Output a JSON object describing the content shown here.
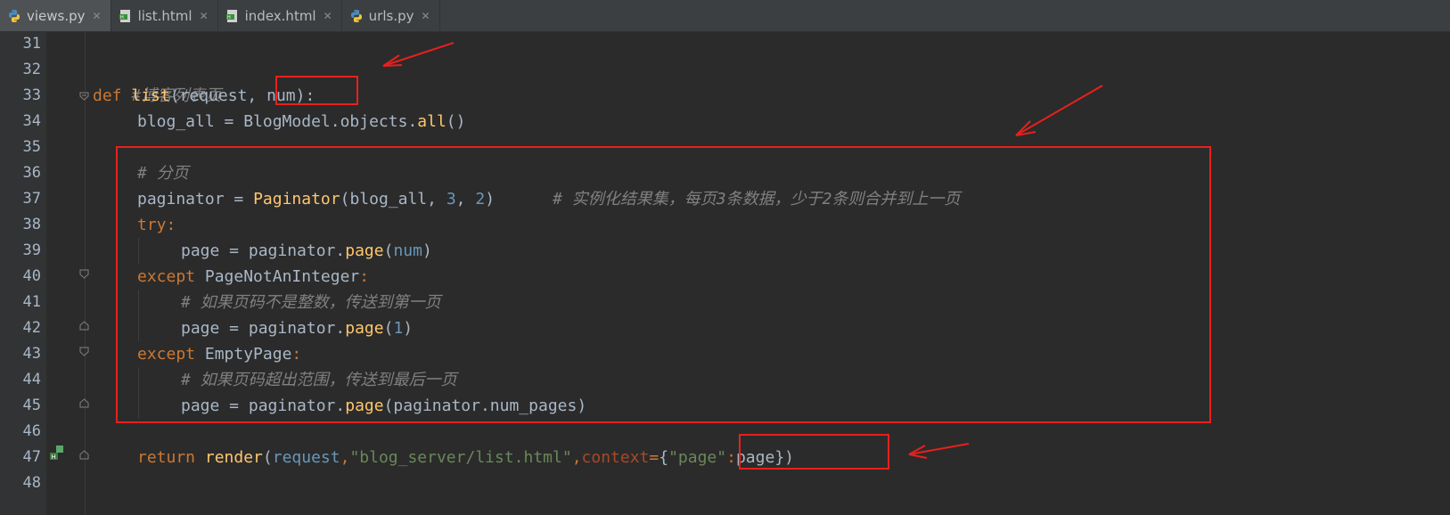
{
  "tabs": [
    {
      "label": "views.py",
      "icon": "python-file-icon",
      "active": true
    },
    {
      "label": "list.html",
      "icon": "html-file-icon",
      "active": false
    },
    {
      "label": "index.html",
      "icon": "html-file-icon",
      "active": false
    },
    {
      "label": "urls.py",
      "icon": "python-file-icon",
      "active": false
    }
  ],
  "tab_close_glyph": "✕",
  "line_numbers": [
    "31",
    "32",
    "33",
    "34",
    "35",
    "36",
    "37",
    "38",
    "39",
    "40",
    "41",
    "42",
    "43",
    "44",
    "45",
    "46",
    "47",
    "48"
  ],
  "code": {
    "l32": "#博客列表页",
    "l33_def": "def",
    "l33_name": "list",
    "l33_open": "(",
    "l33_p1": "request",
    "l33_comma": ",",
    "l33_p2": " num",
    "l33_close": "):",
    "l34_var": "blog_all",
    "l34_eq": " = BlogModel.objects.",
    "l34_call": "all",
    "l34_end": "()",
    "l36": "# 分页",
    "l37_var": "paginator",
    "l37_eq": " = ",
    "l37_cls": "Paginator",
    "l37_a": "(blog_all, ",
    "l37_n1": "3",
    "l37_b": ", ",
    "l37_n2": "2",
    "l37_c": ")",
    "l37_cm": "      # 实例化结果集，每页3条数据，少于2条则合并到上一页",
    "l38_kw": "try",
    "l38_colon": ":",
    "l39_a": "page = paginator.",
    "l39_fn": "page",
    "l39_o": "(",
    "l39_arg": "num",
    "l39_c": ")",
    "l40_kw": "except",
    "l40_exc": " PageNotAnInteger",
    "l40_colon": ":",
    "l41": "# 如果页码不是整数，传送到第一页",
    "l42_a": "page = paginator.",
    "l42_fn": "page",
    "l42_o": "(",
    "l42_n": "1",
    "l42_c": ")",
    "l43_kw": "except",
    "l43_exc": " EmptyPage",
    "l43_colon": ":",
    "l44": "# 如果页码超出范围，传送到最后一页",
    "l45_a": "page = paginator.",
    "l45_fn": "page",
    "l45_b": "(paginator.num_pages)",
    "l47_kw": "return",
    "l47_fn": " render",
    "l47_o": "(",
    "l47_req": "request",
    "l47_comma": ",",
    "l47_str": "\"blog_server/list.html\"",
    "l47_comma2": ",",
    "l47_kwarg": "context",
    "l47_eq": "=",
    "l47_br": "{",
    "l47_key": "\"page\"",
    "l47_colon": ":",
    "l47_val": "page",
    "l47_end": "})"
  },
  "colors": {
    "keyword": "#cc7832",
    "function": "#ffc66d",
    "comment": "#808080",
    "number": "#6897bb",
    "string": "#6a8759",
    "kwarg": "#aa4926",
    "annotation_red": "#e8201c",
    "background": "#2b2b2b"
  }
}
